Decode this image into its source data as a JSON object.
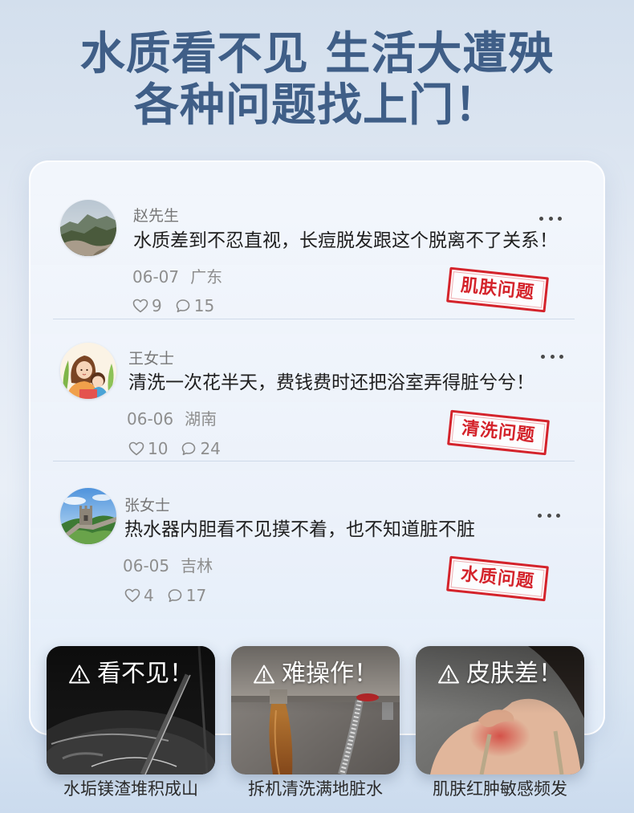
{
  "headline": {
    "line1": "水质看不见 生活大遭殃",
    "line2": "各种问题找上门！"
  },
  "feed": {
    "comments": [
      {
        "name": "赵先生",
        "text": "水质差到不忍直视，长痘脱发跟这个脱离不了关系！",
        "date": "06-07",
        "location": "广东",
        "likes": "9",
        "replies": "15",
        "tag": "肌肤问题"
      },
      {
        "name": "王女士",
        "text": "清洗一次花半天，费钱费时还把浴室弄得脏兮兮！",
        "date": "06-06",
        "location": "湖南",
        "likes": "10",
        "replies": "24",
        "tag": "清洗问题"
      },
      {
        "name": "张女士",
        "text": "热水器内胆看不见摸不着，也不知道脏不脏",
        "date": "06-05",
        "location": "吉林",
        "likes": "4",
        "replies": "17",
        "tag": "水质问题"
      }
    ],
    "icons": {
      "like": "heart-icon",
      "reply": "comment-bubble-icon",
      "more": "more-dots-icon"
    }
  },
  "problems": [
    {
      "label": "看不见！",
      "caption": "水垢镁渣堆积成山",
      "icon": "warning-triangle-icon"
    },
    {
      "label": "难操作！",
      "caption": "拆机清洗满地脏水",
      "icon": "warning-triangle-icon"
    },
    {
      "label": "皮肤差！",
      "caption": "肌肤红肿敏感频发",
      "icon": "warning-triangle-icon"
    }
  ],
  "colors": {
    "headline": "#3f5e87",
    "stamp": "#d4232b",
    "card": "#eef3fa",
    "background": "#dde7f3"
  }
}
